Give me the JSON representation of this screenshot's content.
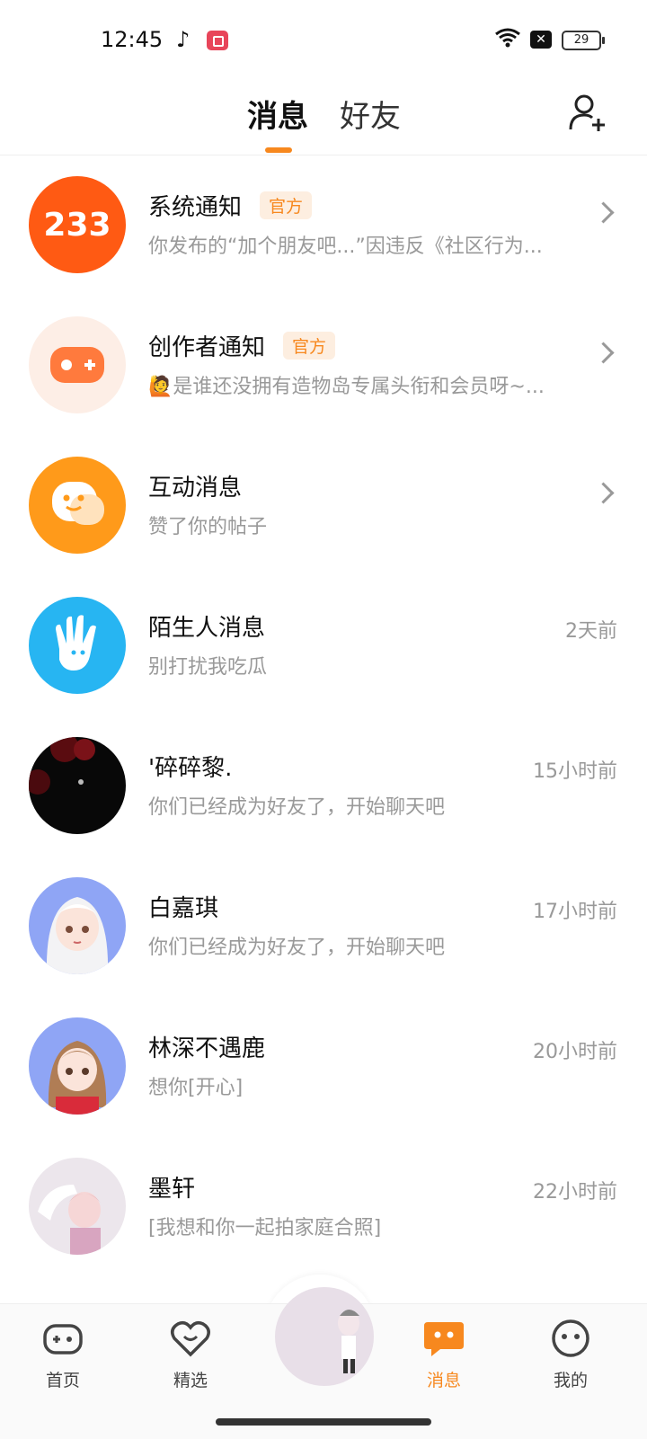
{
  "status_bar": {
    "time": "12:45",
    "battery": "29"
  },
  "header": {
    "tabs": [
      "消息",
      "好友"
    ],
    "active_tab": "消息"
  },
  "messages": [
    {
      "title": "系统通知",
      "badge": "官方",
      "subtitle": "你发布的“加个朋友吧...”因违反《社区行为...",
      "time": "",
      "avatar": "233-logo"
    },
    {
      "title": "创作者通知",
      "badge": "官方",
      "subtitle": "🙋是谁还没拥有造物岛专属头衔和会员呀~...",
      "time": "",
      "avatar": "gamepad-icon"
    },
    {
      "title": "互动消息",
      "badge": "",
      "subtitle": "赞了你的帖子",
      "time": "",
      "avatar": "chat-bubble-icon"
    },
    {
      "title": "陌生人消息",
      "badge": "",
      "subtitle": "别打扰我吃瓜",
      "time": "2天前",
      "avatar": "hand-icon"
    },
    {
      "title": "'碎碎黎.",
      "badge": "",
      "subtitle": "你们已经成为好友了，开始聊天吧",
      "time": "15小时前",
      "avatar": "user-avatar"
    },
    {
      "title": "白嘉琪",
      "badge": "",
      "subtitle": "你们已经成为好友了，开始聊天吧",
      "time": "17小时前",
      "avatar": "user-avatar"
    },
    {
      "title": "林深不遇鹿",
      "badge": "",
      "subtitle": "想你[开心]",
      "time": "20小时前",
      "avatar": "user-avatar"
    },
    {
      "title": "墨轩",
      "badge": "",
      "subtitle": "[我想和你一起拍家庭合照]",
      "time": "22小时前",
      "avatar": "user-avatar"
    }
  ],
  "tabbar": {
    "items": [
      "首页",
      "精选",
      "消息",
      "我的"
    ],
    "active": "消息"
  },
  "colors": {
    "accent": "#f7881e",
    "badge_bg": "#fdeee0"
  }
}
